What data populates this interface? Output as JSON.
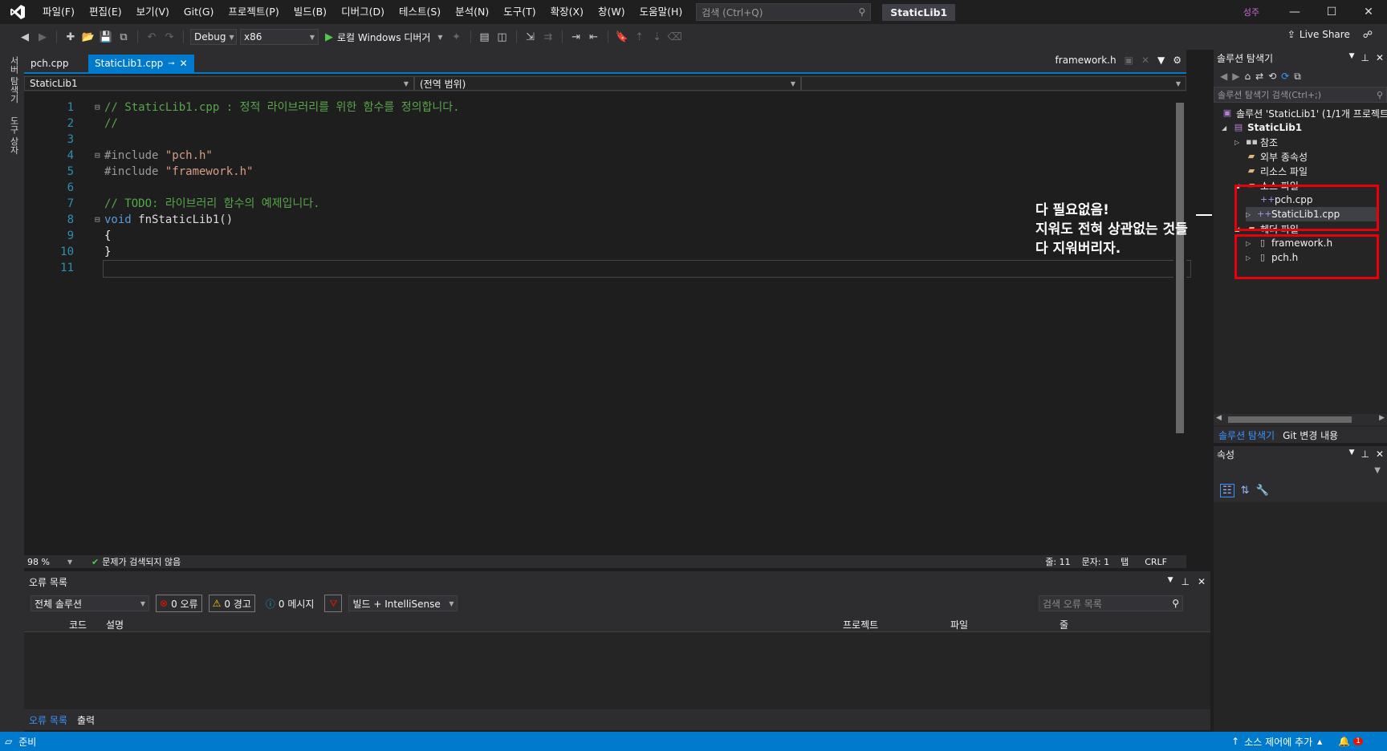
{
  "titlebar": {
    "menu": [
      "파일(F)",
      "편집(E)",
      "보기(V)",
      "Git(G)",
      "프로젝트(P)",
      "빌드(B)",
      "디버그(D)",
      "테스트(S)",
      "분석(N)",
      "도구(T)",
      "확장(X)",
      "창(W)",
      "도움말(H)"
    ],
    "search_placeholder": "검색 (Ctrl+Q)",
    "solution_name": "StaticLib1",
    "user_initials": "성주",
    "minimize": "—",
    "maximize": "☐",
    "close": "✕"
  },
  "toolbar": {
    "config": "Debug",
    "platform": "x86",
    "run_label": "로컬 Windows 디버거",
    "live_share": "Live Share"
  },
  "left_rail": {
    "item1": "서버 탐색기",
    "item2": "도구 상자"
  },
  "editor": {
    "tabs": [
      {
        "label": "pch.cpp",
        "active": false
      },
      {
        "label": "StaticLib1.cpp",
        "active": true
      }
    ],
    "preview_tab": "framework.h",
    "nav_project": "StaticLib1",
    "nav_scope": "(전역 범위)",
    "lines": [
      {
        "n": "1",
        "text": "// StaticLib1.cpp : 정적 라이브러리를 위한 함수를 정의합니다."
      },
      {
        "n": "2",
        "text": "//"
      },
      {
        "n": "3",
        "text": ""
      },
      {
        "n": "4",
        "pre": "#include ",
        "str": "\"pch.h\""
      },
      {
        "n": "5",
        "pre": "#include ",
        "str": "\"framework.h\""
      },
      {
        "n": "6",
        "text": ""
      },
      {
        "n": "7",
        "text": "// TODO: 라이브러리 함수의 예제입니다."
      },
      {
        "n": "8",
        "kw": "void",
        "fn": " fnStaticLib1()"
      },
      {
        "n": "9",
        "text": "{"
      },
      {
        "n": "10",
        "text": "}"
      },
      {
        "n": "11",
        "text": ""
      }
    ],
    "zoom": "98 %",
    "issues": "문제가 검색되지 않음",
    "line_info": "줄: 11",
    "char_info": "문자: 1",
    "tab_info": "탭",
    "eol": "CRLF"
  },
  "annotation": {
    "line1": "다 필요없음!",
    "line2": "지워도 전혀 상관없는 것들",
    "line3": "다 지워버리자."
  },
  "error_list": {
    "title": "오류 목록",
    "scope": "전체 솔루션",
    "errors": "0 오류",
    "warnings": "0 경고",
    "messages": "0 메시지",
    "build_filter": "빌드 + IntelliSense",
    "search_placeholder": "검색 오류 목록",
    "col_code": "코드",
    "col_desc": "설명",
    "col_project": "프로젝트",
    "col_file": "파일",
    "col_line": "줄"
  },
  "bottom_tabs": {
    "errors": "오류 목록",
    "output": "출력"
  },
  "solution_explorer": {
    "title": "솔루션 탐색기",
    "search_placeholder": "솔루션 탐색기 검색(Ctrl+;)",
    "solution": "솔루션 'StaticLib1' (1/1개 프로젝트)",
    "project": "StaticLib1",
    "references": "참조",
    "external_deps": "외부 종속성",
    "resource_files": "리소스 파일",
    "source_files": "소스 파일",
    "src1": "pch.cpp",
    "src2": "StaticLib1.cpp",
    "header_files": "헤더 파일",
    "hdr1": "framework.h",
    "hdr2": "pch.h",
    "tab_explorer": "솔루션 탐색기",
    "tab_git": "Git 변경 내용"
  },
  "properties": {
    "title": "속성"
  },
  "statusbar": {
    "ready": "준비",
    "source_control": "소스 제어에 추가",
    "notifications": "1"
  },
  "colors": {
    "accent": "#007acc",
    "annotation_box": "#e8000b",
    "comment": "#57a64a",
    "string": "#d69d85",
    "keyword": "#569cd6"
  }
}
